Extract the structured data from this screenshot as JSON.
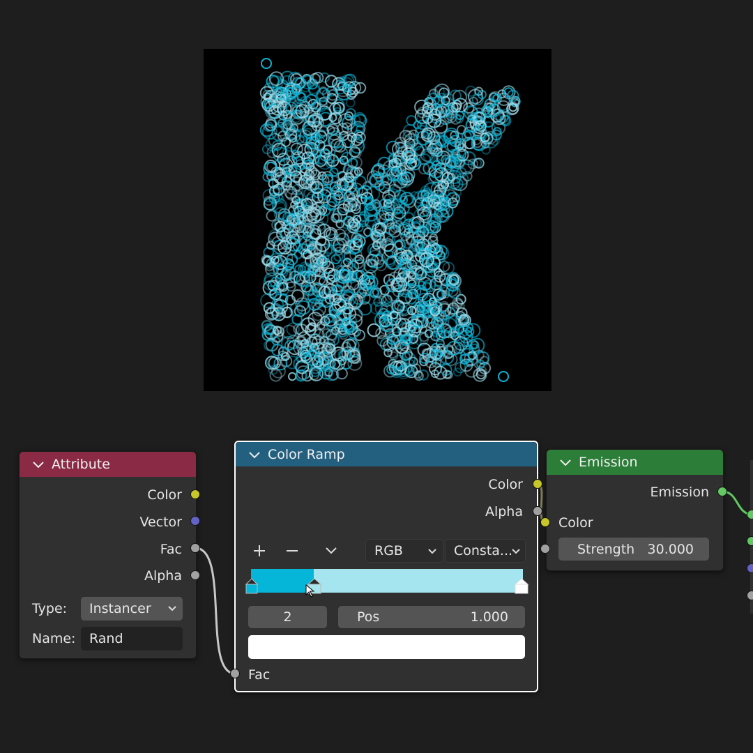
{
  "attribute_node": {
    "title": "Attribute",
    "outputs": [
      "Color",
      "Vector",
      "Fac",
      "Alpha"
    ],
    "type_label": "Type:",
    "type_value": "Instancer",
    "name_label": "Name:",
    "name_value": "Rand"
  },
  "color_ramp_node": {
    "title": "Color Ramp",
    "outputs": [
      "Color",
      "Alpha"
    ],
    "color_mode": "RGB",
    "interpolation": "Consta...",
    "stop_index": "2",
    "pos_label": "Pos",
    "pos_value": "1.000",
    "input": "Fac",
    "ramp_colors": [
      "#06b6d9",
      "#a4e5f0",
      "#ffffff"
    ]
  },
  "emission_node": {
    "title": "Emission",
    "output": "Emission",
    "input_color": "Color",
    "strength_label": "Strength",
    "strength_value": "30.000"
  },
  "colors": {
    "attribute_header": "#8b2a45",
    "ramp_header": "#23607f",
    "emission_header": "#2c7d38",
    "socket_color": "#c7c729",
    "socket_vector": "#6363c7",
    "socket_float": "#a1a1a1",
    "socket_shader": "#63c763",
    "particle_cyan": "#0bb4d6"
  },
  "icons": [
    "chevron-down-icon",
    "plus-icon",
    "minus-icon",
    "mouse-cursor-icon"
  ]
}
